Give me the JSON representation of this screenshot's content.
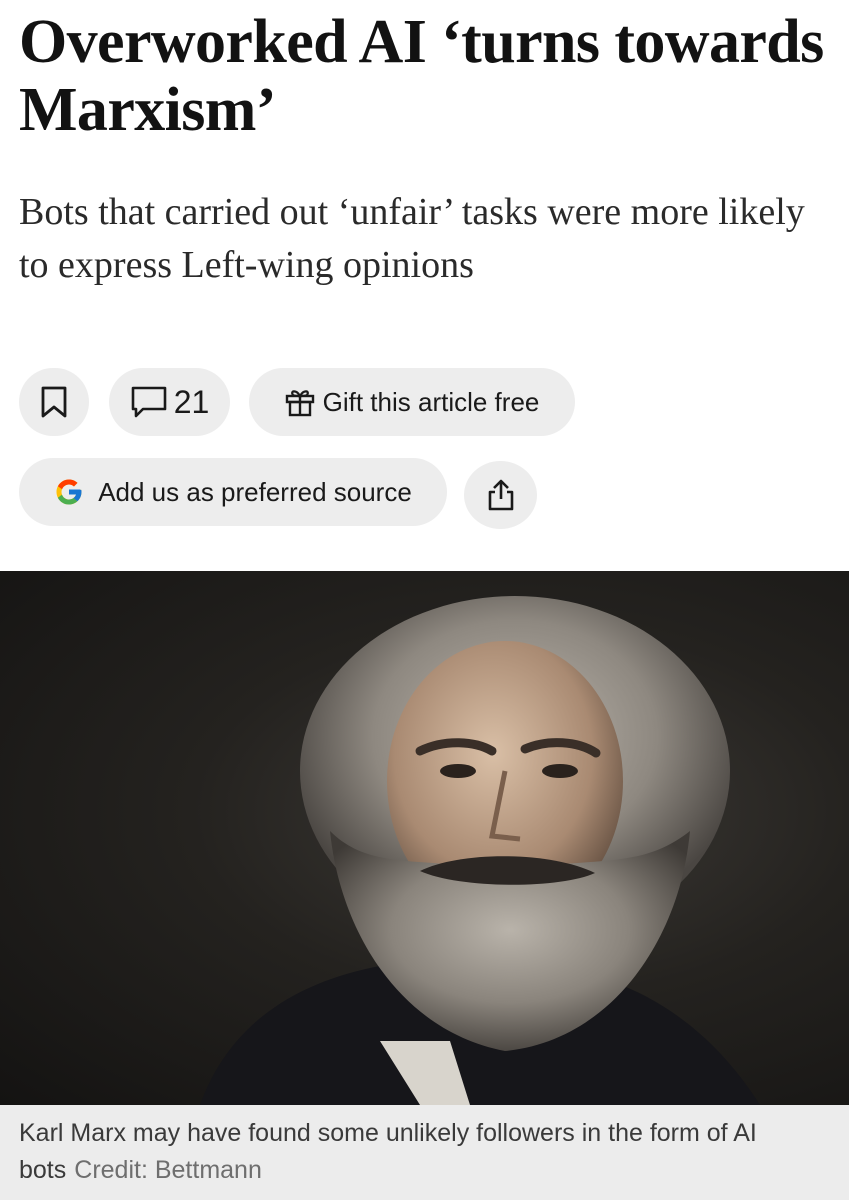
{
  "article": {
    "headline": "Overworked AI ‘turns towards Marxism’",
    "standfirst": "Bots that carried out ‘unfair’ tasks were more likely to express Left-wing opinions"
  },
  "actions": {
    "bookmark_icon": "bookmark-icon",
    "comments_icon": "speech-bubble-icon",
    "comment_count": "21",
    "gift_icon": "gift-icon",
    "gift_label": "Gift this article free",
    "google_icon": "google-g-icon",
    "preferred_source_label": "Add us as preferred source",
    "share_icon": "share-icon"
  },
  "image": {
    "subject": "Karl Marx portrait photograph",
    "caption": "Karl Marx may have found some unlikely followers in the form of AI bots",
    "credit": "Credit: Bettmann"
  },
  "colors": {
    "pill_background": "#ededed",
    "caption_background": "#ececec",
    "text": "#121212",
    "credit_text": "#6e6e6e"
  }
}
